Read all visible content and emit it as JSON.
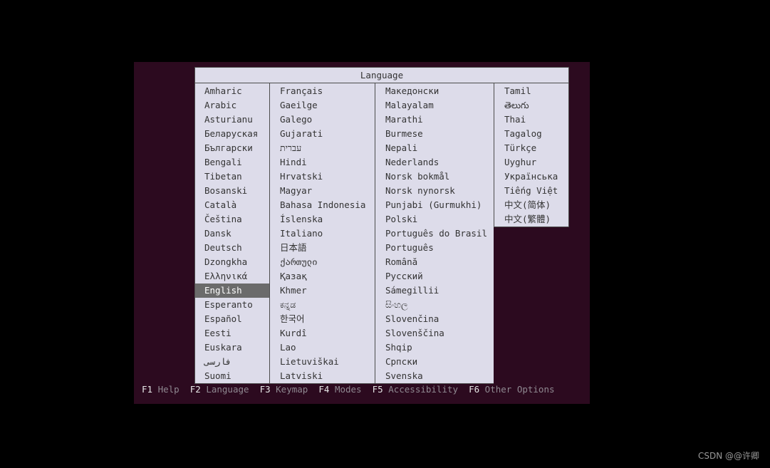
{
  "window": {
    "title": "Language"
  },
  "language_menu": {
    "columns": [
      {
        "items": [
          "Amharic",
          "Arabic",
          "Asturianu",
          "Беларуская",
          "Български",
          "Bengali",
          "Tibetan",
          "Bosanski",
          "Català",
          "Čeština",
          "Dansk",
          "Deutsch",
          "Dzongkha",
          "Ελληνικά",
          "English",
          "Esperanto",
          "Español",
          "Eesti",
          "Euskara",
          "فارسی",
          "Suomi"
        ],
        "selected_index": 14
      },
      {
        "items": [
          "Français",
          "Gaeilge",
          "Galego",
          "Gujarati",
          "עברית",
          "Hindi",
          "Hrvatski",
          "Magyar",
          "Bahasa Indonesia",
          "Íslenska",
          "Italiano",
          "日本語",
          "ქართული",
          "Қазақ",
          "Khmer",
          "ಕನ್ನಡ",
          "한국어",
          "Kurdî",
          "Lao",
          "Lietuviškai",
          "Latviski"
        ]
      },
      {
        "items": [
          "Македонски",
          "Malayalam",
          "Marathi",
          "Burmese",
          "Nepali",
          "Nederlands",
          "Norsk bokmål",
          "Norsk nynorsk",
          "Punjabi (Gurmukhi)",
          "Polski",
          "Português do Brasil",
          "Português",
          "Română",
          "Русский",
          "Sámegillii",
          "සිංහල",
          "Slovenčina",
          "Slovenščina",
          "Shqip",
          "Српски",
          "Svenska"
        ]
      },
      {
        "items": [
          "Tamil",
          "తెలుగు",
          "Thai",
          "Tagalog",
          "Türkçe",
          "Uyghur",
          "Українська",
          "Tiếng Việt",
          "中文(简体)",
          "中文(繁體)"
        ]
      }
    ]
  },
  "footer": [
    {
      "key": "F1",
      "label": "Help"
    },
    {
      "key": "F2",
      "label": "Language"
    },
    {
      "key": "F3",
      "label": "Keymap"
    },
    {
      "key": "F4",
      "label": "Modes"
    },
    {
      "key": "F5",
      "label": "Accessibility"
    },
    {
      "key": "F6",
      "label": "Other Options"
    }
  ],
  "watermark": "CSDN @@许卿",
  "colors": {
    "background": "#000000",
    "frame": "#2c0a1f",
    "panel": "#dddcea",
    "border": "#4d4d4d",
    "text": "#333333",
    "highlight": "#6b6b6b",
    "highlight_text": "#ffffff",
    "footer_key": "#e6e6e6",
    "footer_label": "#8f8991",
    "watermark": "#9a9a9a"
  }
}
